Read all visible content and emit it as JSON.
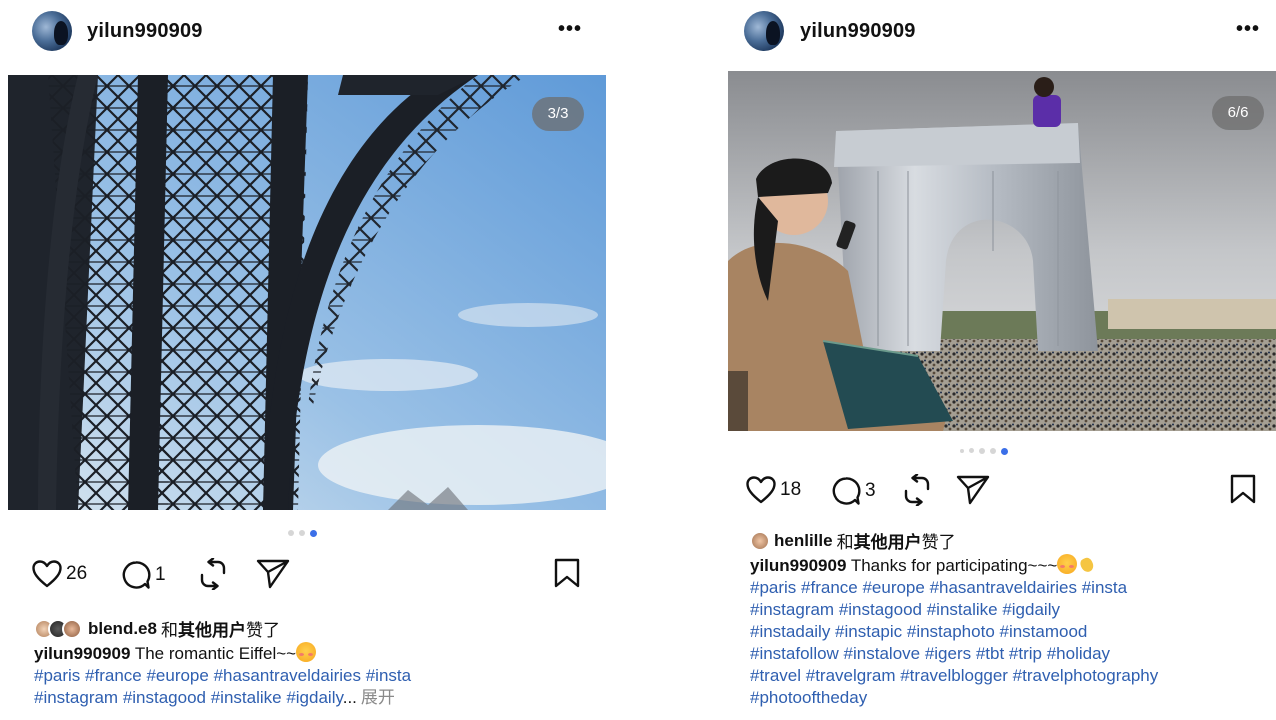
{
  "posts": [
    {
      "username": "yilun990909",
      "more": "•••",
      "counter": "3/3",
      "dots": 3,
      "active_dot": 2,
      "likes": "26",
      "comments": "1",
      "liked_by": {
        "name": "blend.e8",
        "and": "和",
        "others": "其他用户",
        "suffix": "赞了"
      },
      "caption_text": "The romantic Eiffel~~",
      "tags_lines": [
        "#paris #france #europe #hasantraveldairies #insta",
        "#instagram #instagood #instalike #igdaily"
      ],
      "ellipsis": "...",
      "expand": "展开"
    },
    {
      "username": "yilun990909",
      "more": "•••",
      "counter": "6/6",
      "dots": 5,
      "active_dot": 4,
      "likes": "18",
      "comments": "3",
      "liked_by": {
        "name": "henlille",
        "and": "和",
        "others": "其他用户",
        "suffix": "赞了"
      },
      "caption_text": "Thanks for participating~~~",
      "tags_lines": [
        "#paris #france #europe #hasantraveldairies #insta",
        "#instagram #instagood #instalike #igdaily",
        "#instadaily #instapic #instaphoto #instamood",
        "#instafollow #instalove #igers #tbt #trip #holiday",
        "#travel #travelgram #travelblogger #travelphotography",
        "#photooftheday"
      ]
    }
  ],
  "colors": {
    "hashtag": "#2f5fb0",
    "active_dot": "#3b6fe8"
  },
  "icons": [
    "heart-icon",
    "comment-icon",
    "repost-icon",
    "send-icon",
    "bookmark-icon",
    "more-icon"
  ]
}
